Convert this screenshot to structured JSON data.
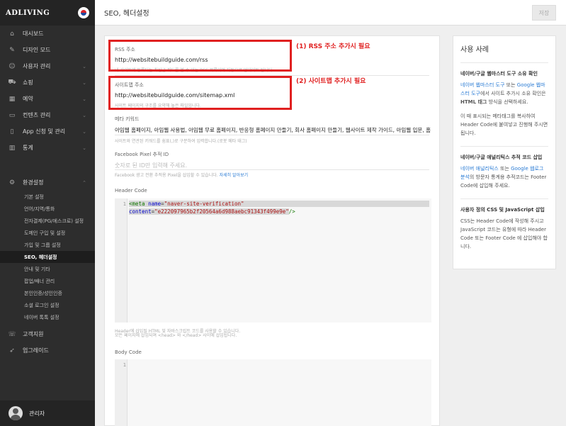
{
  "sidebar": {
    "brand": "ADLIVING",
    "items": [
      {
        "label": "대시보드",
        "icon": "home-icon",
        "glyph": "⌂",
        "chevron": false
      },
      {
        "label": "디자인 모드",
        "icon": "brush-icon",
        "glyph": "✎",
        "chevron": false
      },
      {
        "label": "사용자 관리",
        "icon": "user-icon",
        "glyph": "☺",
        "chevron": true
      },
      {
        "label": "쇼핑",
        "icon": "cart-icon",
        "glyph": "⛟",
        "chevron": true
      },
      {
        "label": "예약",
        "icon": "calendar-icon",
        "glyph": "▦",
        "chevron": true
      },
      {
        "label": "컨텐츠 관리",
        "icon": "inbox-icon",
        "glyph": "▭",
        "chevron": true
      },
      {
        "label": "App 신청 및 관리",
        "icon": "mobile-icon",
        "glyph": "▯",
        "chevron": true
      },
      {
        "label": "통계",
        "icon": "bar-chart-icon",
        "glyph": "▥",
        "chevron": true
      }
    ],
    "settings": {
      "label": "환경설정",
      "icon": "gear-icon",
      "glyph": "⚙"
    },
    "sub_items": [
      "기본 설정",
      "언어/지역/통화",
      "전자결제(PG/에스크로) 설정",
      "도메인 구입 및 설정",
      "가입 및 그룹 설정",
      "SEO, 헤더설정",
      "안내 및 기타",
      "팝업/배너 관리",
      "본인인증/성인인증",
      "소셜 로그인 설정",
      "네이버 톡톡 설정"
    ],
    "active_sub": "SEO, 헤더설정",
    "extra_items": [
      {
        "label": "고객지원",
        "icon": "support-icon",
        "glyph": "☏"
      },
      {
        "label": "업그레이드",
        "icon": "rocket-icon",
        "glyph": "➶"
      }
    ],
    "admin_name": "관리자"
  },
  "header": {
    "title": "SEO, 헤더설정",
    "save_label": "저장"
  },
  "main": {
    "rss": {
      "label": "RSS 주소",
      "value": "http://websitebuildguide.com/rss",
      "help": "내 사이트에 등록되는 최신글 피드를 볼 수 있는 RSS 목록이며 자동으로 업데이트 됩니다."
    },
    "sitemap": {
      "label": "사이트맵 주소",
      "value": "http://websitebuildguide.com/sitemap.xml",
      "help": "사이트 페이지의 구조를 요약해 놓은 파일입니다."
    },
    "meta": {
      "label": "메타 키워드",
      "value": "아임웹 홈페이지, 아임웹 사용법, 아임웹 무료 홈페이지, 반응형 홈페이지 만들기, 회사 홈페이지 만들기, 웹사이트 제작 가이드, 아임웹 입문, 홈",
      "help": "사이트와 연관된 키워드를 쉼표(,)로 구분하여 입력합니다.(로봇 메타 태그)"
    },
    "pixel": {
      "label": "Facebook Pixel 추적 ID",
      "placeholder": "숫자로 된 ID만 입력해 주세요.",
      "help": "Facebook 광고 전환 추적용 Pixel을 삽입할 수 있습니다.",
      "help_link": "자세히 알아보기"
    },
    "header_code": {
      "label": "Header Code",
      "line1_open": "<meta ",
      "line1_attr": "name",
      "line1_eq": "=",
      "line1_val": "\"naver-site-verification\"",
      "line2_attr": "content",
      "line2_eq": "=",
      "line2_val": "\"e222097965b2f20564a6d988aebc91343f499e9e\"",
      "line2_close": "/>",
      "help1": "Header에 삽입될 HTML 및 자바스크립트 코드를 사용할 수 있습니다.",
      "help2": "모든 페이지에 삽입되며 <head> 와 </head> 사이에 삽입됩니다."
    },
    "body_code": {
      "label": "Body Code"
    },
    "line_number": "1"
  },
  "annotations": {
    "rss": "(1) RSS 주소 추가시 필요",
    "sitemap": "(2) 사이트맵 추가시 필요",
    "color": "#e02020"
  },
  "side_panel": {
    "title": "사용 사례",
    "blocks": [
      {
        "head": "네이버/구글 웹마스터 도구 소유 확인",
        "p1_link1": "네이버 웹마스터 도구",
        "p1_t1": " 또는 ",
        "p1_link2": "Google 웹마스터 도구",
        "p1_t2": "에서 사이트 추가시 소유 확인은 ",
        "p1_bold": "HTML 태그",
        "p1_t3": " 방식을 선택하세요.",
        "p2": "이 때 표시되는 메타태그를 복사하여 Header Code에 붙여넣고 진행해 주시면 됩니다."
      },
      {
        "head": "네이버/구글 애널리틱스 추적 코드 삽입",
        "link1": "네이버 애널리틱스",
        "t1": " 또는 ",
        "link2": "Google 웹로그 분석",
        "t2": "의 방문자 통계용 추적코드는 Footer Code에 삽입해 주세요."
      },
      {
        "head": "사용자 정의 CSS 및 JavaScript 삽입",
        "text": "CSS는 Header Code에 작성해 주시고 JavaScript 코드는 유형에 따라 Header Code 또는 Footer Code 에 삽입해야 합니다."
      }
    ]
  }
}
